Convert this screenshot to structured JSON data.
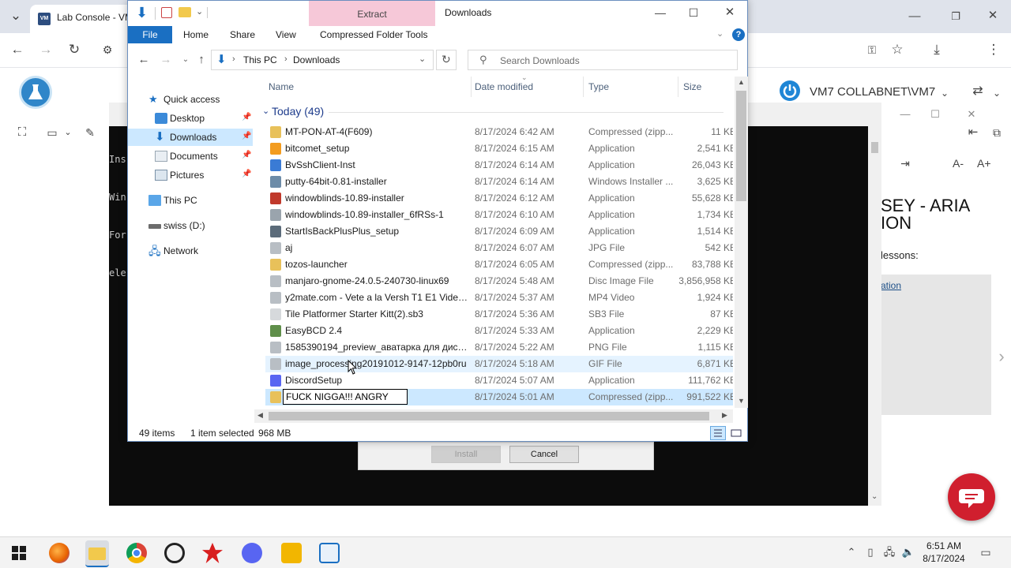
{
  "browser": {
    "tab_title": "Lab Console - VM",
    "tab_favicon_text": "VM"
  },
  "app": {
    "vm_label": "VM7 COLLABNET\\VM7",
    "course_title": "SEY - ARIA\nION",
    "lessons_text": "lessons:",
    "lesson_link": "ation",
    "font_smaller": "A-",
    "font_larger": "A+"
  },
  "vm": {
    "console_lines": [
      "Ins",
      "Win",
      "For",
      "ele"
    ],
    "install_button": "Install",
    "cancel_button": "Cancel"
  },
  "explorer": {
    "title": "Downloads",
    "extract_label": "Extract",
    "ribbon_tabs": [
      "File",
      "Home",
      "Share",
      "View",
      "Compressed Folder Tools"
    ],
    "breadcrumb": [
      "This PC",
      "Downloads"
    ],
    "search_placeholder": "Search Downloads",
    "nav": {
      "quick_access": "Quick access",
      "desktop": "Desktop",
      "downloads": "Downloads",
      "documents": "Documents",
      "pictures": "Pictures",
      "this_pc": "This PC",
      "swiss_drive": "swiss (D:)",
      "network": "Network"
    },
    "columns": {
      "name": "Name",
      "date": "Date modified",
      "type": "Type",
      "size": "Size"
    },
    "group_label": "Today (49)",
    "files": [
      {
        "name": "MT-PON-AT-4(F609)",
        "date": "8/17/2024 6:42 AM",
        "type": "Compressed (zipp...",
        "size": "11 KB",
        "icon_color": "#e8c15a"
      },
      {
        "name": "bitcomet_setup",
        "date": "8/17/2024 6:15 AM",
        "type": "Application",
        "size": "2,541 KB",
        "icon_color": "#f39c1f"
      },
      {
        "name": "BvSshClient-Inst",
        "date": "8/17/2024 6:14 AM",
        "type": "Application",
        "size": "26,043 KB",
        "icon_color": "#3a7bd5"
      },
      {
        "name": "putty-64bit-0.81-installer",
        "date": "8/17/2024 6:14 AM",
        "type": "Windows Installer ...",
        "size": "3,625 KB",
        "icon_color": "#6d8ca8"
      },
      {
        "name": "windowblinds-10.89-installer",
        "date": "8/17/2024 6:12 AM",
        "type": "Application",
        "size": "55,628 KB",
        "icon_color": "#c0392b"
      },
      {
        "name": "windowblinds-10.89-installer_6fRSs-1",
        "date": "8/17/2024 6:10 AM",
        "type": "Application",
        "size": "1,734 KB",
        "icon_color": "#9aa4ad"
      },
      {
        "name": "StartIsBackPlusPlus_setup",
        "date": "8/17/2024 6:09 AM",
        "type": "Application",
        "size": "1,514 KB",
        "icon_color": "#5b6b7a"
      },
      {
        "name": "aj",
        "date": "8/17/2024 6:07 AM",
        "type": "JPG File",
        "size": "542 KB",
        "icon_color": "#b8bec4"
      },
      {
        "name": "tozos-launcher",
        "date": "8/17/2024 6:05 AM",
        "type": "Compressed (zipp...",
        "size": "83,788 KB",
        "icon_color": "#e8c15a"
      },
      {
        "name": "manjaro-gnome-24.0.5-240730-linux69",
        "date": "8/17/2024 5:48 AM",
        "type": "Disc Image File",
        "size": "3,856,958 KB",
        "icon_color": "#b8bec4"
      },
      {
        "name": "y2mate.com - Vete a la Versh  T1 E1 Video...",
        "date": "8/17/2024 5:37 AM",
        "type": "MP4 Video",
        "size": "1,924 KB",
        "icon_color": "#b8bec4"
      },
      {
        "name": "Tile Platformer Starter Kitt(2).sb3",
        "date": "8/17/2024 5:36 AM",
        "type": "SB3 File",
        "size": "87 KB",
        "icon_color": "#d6d9dc"
      },
      {
        "name": "EasyBCD 2.4",
        "date": "8/17/2024 5:33 AM",
        "type": "Application",
        "size": "2,229 KB",
        "icon_color": "#5f8f4a"
      },
      {
        "name": "1585390194_preview_аватарка для диско...",
        "date": "8/17/2024 5:22 AM",
        "type": "PNG File",
        "size": "1,115 KB",
        "icon_color": "#b8bec4"
      },
      {
        "name": "image_processing20191012-9147-12pb0ru",
        "date": "8/17/2024 5:18 AM",
        "type": "GIF File",
        "size": "6,871 KB",
        "icon_color": "#b8bec4"
      },
      {
        "name": "DiscordSetup",
        "date": "8/17/2024 5:07 AM",
        "type": "Application",
        "size": "111,762 KB",
        "icon_color": "#5865f2"
      },
      {
        "name": "FUCK NIGGA!!! ANGRY",
        "date": "8/17/2024 5:01 AM",
        "type": "Compressed (zipp...",
        "size": "991,522 KB",
        "icon_color": "#e8c15a"
      }
    ],
    "status": {
      "items": "49 items",
      "selected": "1 item selected",
      "size": "968 MB"
    }
  },
  "taskbar": {
    "time": "6:51 AM",
    "date": "8/17/2024"
  }
}
